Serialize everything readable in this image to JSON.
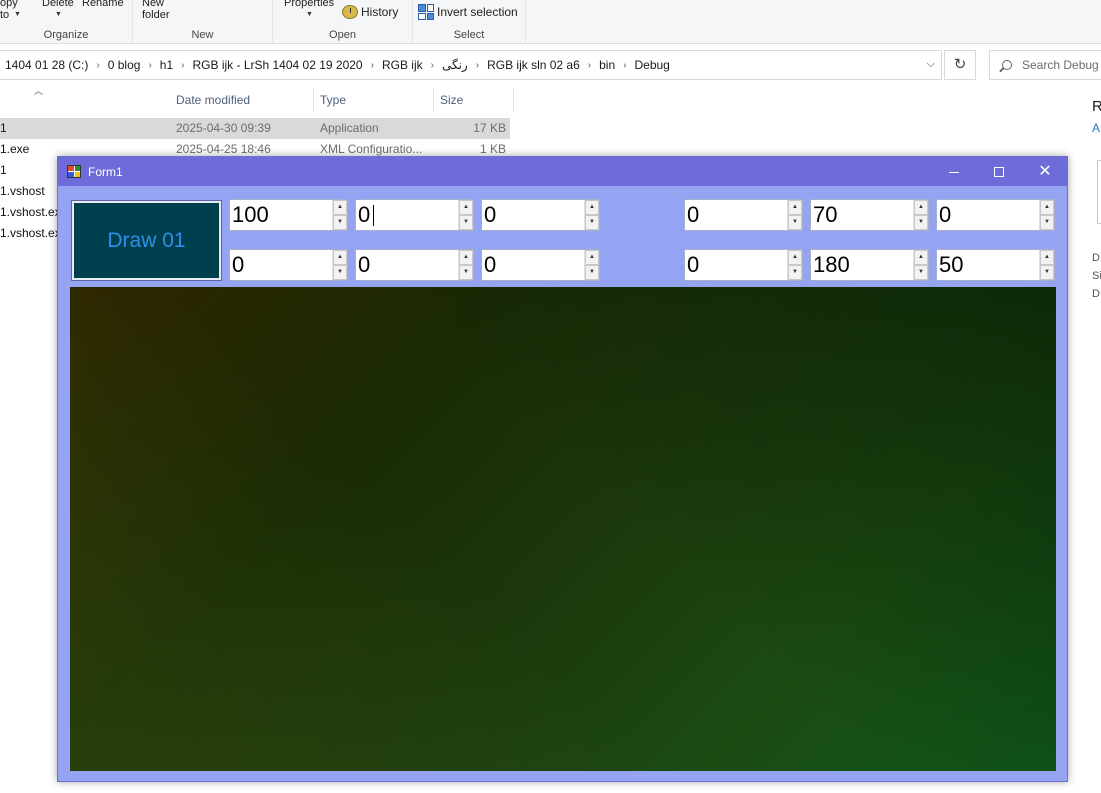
{
  "ribbon": {
    "copy_to_label": "opy\nto",
    "delete_label": "Delete",
    "rename_label": "Rename",
    "new_folder_label": "New\nfolder",
    "properties_label": "Properties",
    "history_label": "History",
    "invert_selection_label": "Invert selection",
    "groups": {
      "organize": "Organize",
      "new": "New",
      "open": "Open",
      "select": "Select"
    }
  },
  "address": {
    "crumbs": [
      "1404 01 28 (C:)",
      "0 blog",
      "h1",
      "RGB ijk - LrSh 1404 02 19 2020",
      "RGB ijk",
      "رنگی",
      "RGB ijk sln 02 a6",
      "bin",
      "Debug"
    ],
    "search_placeholder": "Search Debug"
  },
  "file_list": {
    "columns": {
      "date": "Date modified",
      "type": "Type",
      "size": "Size"
    },
    "rows": [
      {
        "name": "1",
        "date": "2025-04-30 09:39",
        "type": "Application",
        "size": "17 KB"
      },
      {
        "name": "1.exe",
        "date": "2025-04-25 18:46",
        "type": "XML Configuratio...",
        "size": "1 KB"
      },
      {
        "name": "1",
        "date": "",
        "type": "",
        "size": ""
      },
      {
        "name": "1.vshost",
        "date": "",
        "type": "",
        "size": ""
      },
      {
        "name": "1.vshost.ex",
        "date": "",
        "type": "",
        "size": ""
      },
      {
        "name": "1.vshost.ex",
        "date": "",
        "type": "",
        "size": ""
      }
    ]
  },
  "right_pane": {
    "letter1": "R",
    "letter2": "A",
    "small1": "D",
    "small2": "Si",
    "small3": "D"
  },
  "form": {
    "title": "Form1",
    "draw_button": "Draw 01",
    "spinners": {
      "r1c1": "100",
      "r1c2": "0",
      "r1c3": "0",
      "r1c4": "0",
      "r1c5": "70",
      "r1c6": "0",
      "r2c1": "0",
      "r2c2": "0",
      "r2c3": "0",
      "r2c4": "0",
      "r2c5": "180",
      "r2c6": "50"
    },
    "up_glyph": "▲",
    "down_glyph": "▼"
  }
}
